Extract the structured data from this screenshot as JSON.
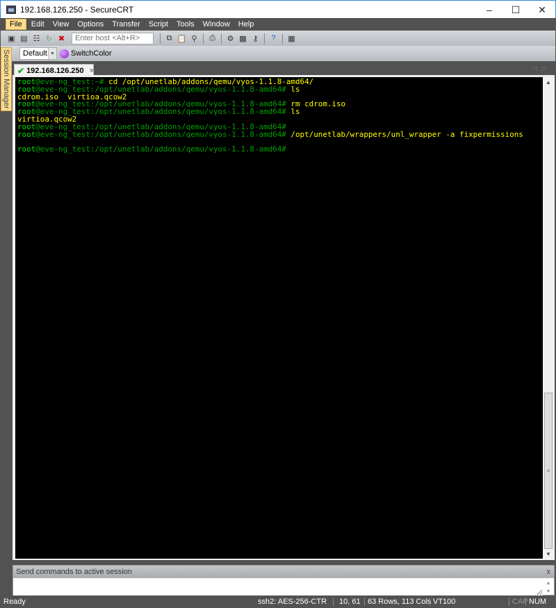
{
  "window": {
    "title": "192.168.126.250 - SecureCRT",
    "minimize": "–",
    "maximize": "☐",
    "close": "✕"
  },
  "menu": [
    "File",
    "Edit",
    "View",
    "Options",
    "Transfer",
    "Script",
    "Tools",
    "Window",
    "Help"
  ],
  "toolbar": {
    "host_placeholder": "Enter host <Alt+R>"
  },
  "buttonbar": {
    "selected": "Default",
    "switch_label": "SwitchColor"
  },
  "session_manager": "Session Manager",
  "tab": {
    "label": "192.168.126.250",
    "close": "×"
  },
  "terminal": {
    "lines": [
      {
        "user": "root",
        "path": "@eve-ng_test:~#",
        "cmd": " cd /opt/unetlab/addons/qemu/vyos-1.1.8-amd64/"
      },
      {
        "user": "root",
        "path": "@eve-ng_test:/opt/unetlab/addons/qemu/vyos-1.1.8-amd64#",
        "cmd": " ls"
      },
      {
        "out": "cdrom.iso  virtioa.qcow2"
      },
      {
        "user": "root",
        "path": "@eve-ng_test:/opt/unetlab/addons/qemu/vyos-1.1.8-amd64#",
        "cmd": " rm cdrom.iso"
      },
      {
        "user": "root",
        "path": "@eve-ng_test:/opt/unetlab/addons/qemu/vyos-1.1.8-amd64#",
        "cmd": " ls"
      },
      {
        "out": "virtioa.qcow2"
      },
      {
        "user": "root",
        "path": "@eve-ng_test:/opt/unetlab/addons/qemu/vyos-1.1.8-amd64#",
        "cmd": ""
      },
      {
        "user": "root",
        "path": "@eve-ng_test:/opt/unetlab/addons/qemu/vyos-1.1.8-amd64#",
        "cmd": " /opt/unetlab/wrappers/unl_wrapper -a fixpermissions"
      },
      {
        "out": ""
      },
      {
        "user": "root",
        "path": "@eve-ng_test:/opt/unetlab/addons/qemu/vyos-1.1.8-amd64#",
        "cmd": ""
      }
    ]
  },
  "command_window": {
    "title": "Send commands to active session",
    "close": "x"
  },
  "status": {
    "ready": "Ready",
    "cipher": "ssh2: AES-256-CTR",
    "cursor": "10,  61",
    "size": "63 Rows, 113 Cols",
    "emulation": "VT100",
    "cap": "CAP",
    "num": "NUM"
  }
}
